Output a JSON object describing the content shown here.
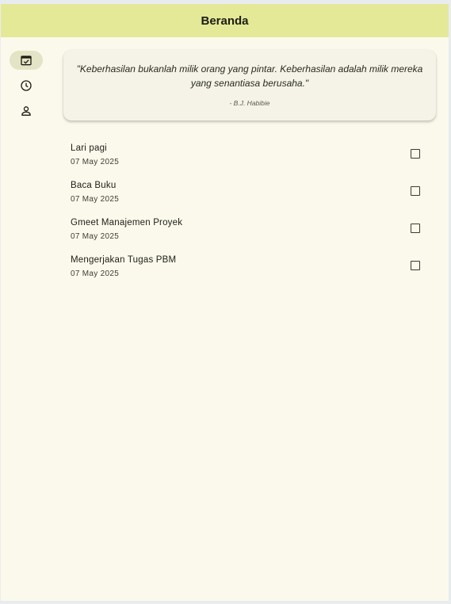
{
  "app": {
    "title": "Beranda"
  },
  "rail": {
    "items": [
      {
        "icon": "calendar-check-icon",
        "active": true
      },
      {
        "icon": "clock-icon",
        "active": false
      },
      {
        "icon": "person-icon",
        "active": false
      }
    ]
  },
  "quote": {
    "text": "\"Keberhasilan bukanlah milik orang yang pintar. Keberhasilan adalah milik mereka yang senantiasa berusaha.\"",
    "author": "- B.J. Habibie"
  },
  "tasks": [
    {
      "title": "Lari pagi",
      "date": "07 May 2025",
      "done": false
    },
    {
      "title": "Baca Buku",
      "date": "07 May 2025",
      "done": false
    },
    {
      "title": "Gmeet Manajemen Proyek",
      "date": "07 May 2025",
      "done": false
    },
    {
      "title": "Mengerjakan Tugas PBM",
      "date": "07 May 2025",
      "done": false
    }
  ]
}
